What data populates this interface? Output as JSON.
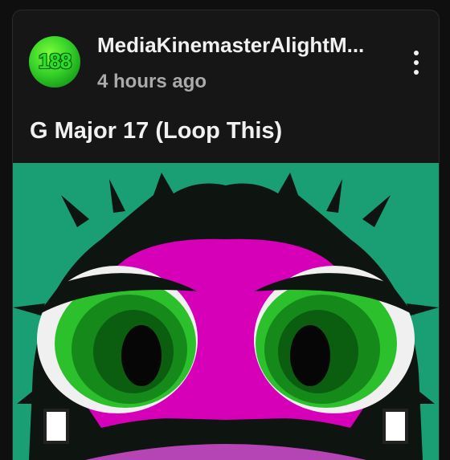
{
  "post": {
    "avatar_text": "188",
    "channel_name": "MediaKinemasterAlightM...",
    "timestamp": "4 hours ago",
    "menu_icon": "more-vert-icon",
    "title": "G Major 17 (Loop This)"
  },
  "colors": {
    "background": "#0f0f0f",
    "card": "#161616",
    "text_primary": "#f1f1f1",
    "text_secondary": "#aaaaaa",
    "thumb_green": "#1a9e74",
    "thumb_magenta": "#d600b8",
    "eye_green": "#2cc12c"
  }
}
